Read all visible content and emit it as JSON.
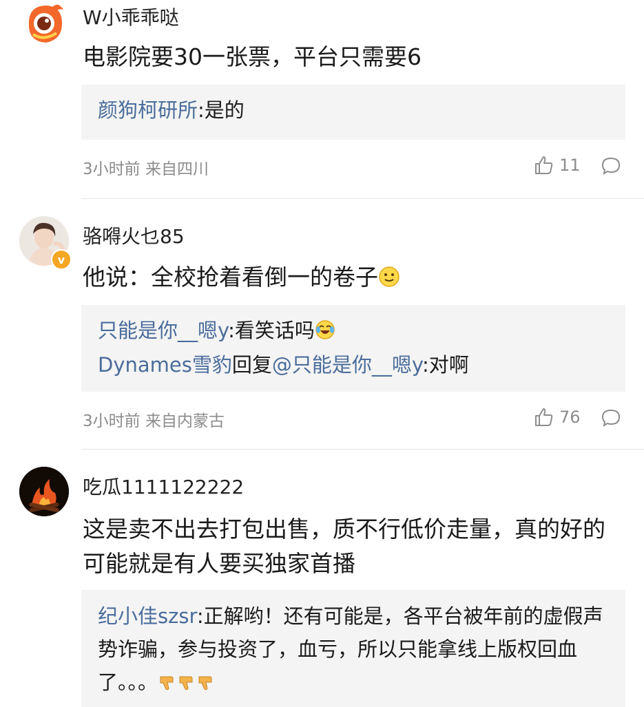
{
  "comments": [
    {
      "username": "W小乖乖哒",
      "text": "电影院要30一张票，平台只需要6",
      "replies": [
        {
          "author": "颜狗柯研所",
          "text": ":是的"
        }
      ],
      "meta": "3小时前 来自四川",
      "likes": "11"
    },
    {
      "username": "骆嘚火乜85",
      "text": "他说：全校抢着看倒一的卷子",
      "replies": [
        {
          "author": "只能是你__嗯y",
          "text": ":看笑话吗"
        },
        {
          "author": "Dynames雪豹",
          "middle": "回复",
          "mention": "@只能是你__嗯y",
          "text": ":对啊"
        }
      ],
      "meta": "3小时前 来自内蒙古",
      "likes": "76"
    },
    {
      "username": "吃瓜1111122222",
      "text": "这是卖不出去打包出售，质不行低价走量，真的好的可能就是有人要买独家首播",
      "replies": [
        {
          "author": "纪小佳szsr",
          "text": ":正解哟！还有可能是，各平台被年前的虚假声势诈骗，参与投资了，血亏，所以只能拿线上版权回血了。。。"
        }
      ]
    }
  ],
  "icons": {
    "like": "thumbs-up-icon",
    "reply": "comment-bubble-icon",
    "verified": "verified-badge-icon"
  },
  "colors": {
    "link": "#4a6c9b",
    "meta": "#8c8c8c",
    "reply_bg": "#f4f4f4",
    "verified": "#f5a623"
  }
}
